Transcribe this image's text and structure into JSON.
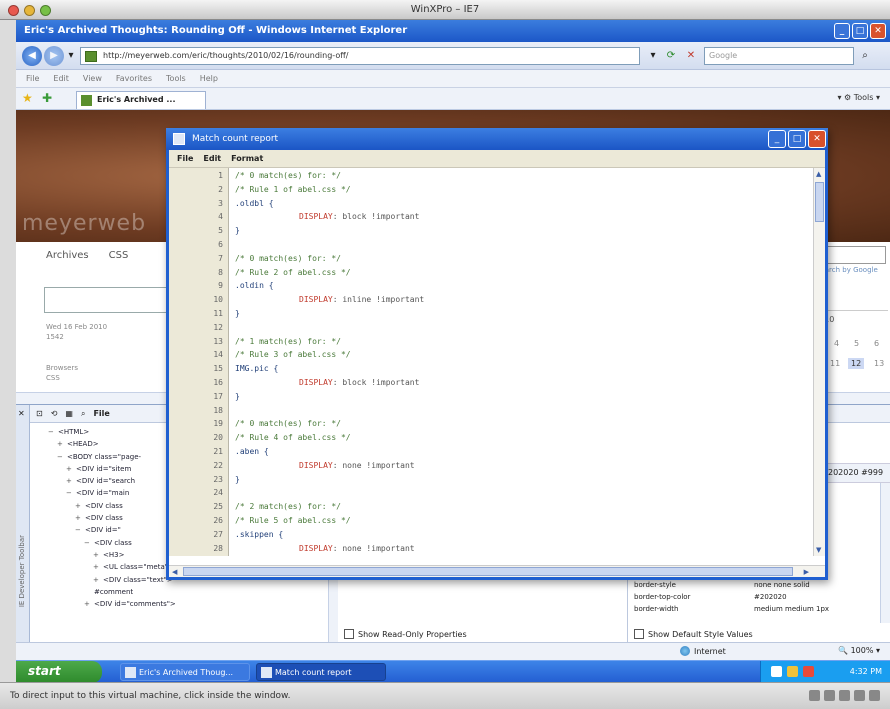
{
  "host": {
    "window_title": "WinXPro – IE7",
    "status_text": "To direct input to this virtual machine, click inside the window."
  },
  "ie": {
    "title": "Eric's Archived Thoughts: Rounding Off - Windows Internet Explorer",
    "address": "http://meyerweb.com/eric/thoughts/2010/02/16/rounding-off/",
    "search_placeholder": "Google",
    "menu": [
      "File",
      "Edit",
      "View",
      "Favorites",
      "Tools",
      "Help"
    ],
    "tab_label": "Eric's Archived ...",
    "tools_label": "Tools",
    "status_zone": "Internet",
    "zoom": "100%"
  },
  "page": {
    "logo_text": "meyerweb",
    "nav": [
      "Archives",
      "CSS"
    ],
    "post_date": [
      "Wed 16 Feb 2010",
      "1542"
    ],
    "post_cat": [
      "Browsers",
      "CSS"
    ],
    "search_by": "Search by Google",
    "calendar_year": "2010",
    "calendar_days": [
      "4",
      "5",
      "6",
      "11",
      "12",
      "13"
    ]
  },
  "devtools": {
    "side_label": "IE Developer Toolbar",
    "toolbar_file": "File",
    "tree": [
      {
        "pm": "−",
        "text": "<HTML>",
        "indent": 0
      },
      {
        "pm": "+",
        "text": "<HEAD>",
        "indent": 1
      },
      {
        "pm": "−",
        "text": "<BODY class=\"page-",
        "indent": 1
      },
      {
        "pm": "+",
        "text": "<DIV id=\"sitem",
        "indent": 2
      },
      {
        "pm": "+",
        "text": "<DIV id=\"search",
        "indent": 2
      },
      {
        "pm": "−",
        "text": "<DIV id=\"main",
        "indent": 2
      },
      {
        "pm": "+",
        "text": "<DIV class",
        "indent": 3
      },
      {
        "pm": "+",
        "text": "<DIV class",
        "indent": 3
      },
      {
        "pm": "−",
        "text": "<DIV id=\"",
        "indent": 3
      },
      {
        "pm": "−",
        "text": "<DIV class",
        "indent": 4
      },
      {
        "pm": "+",
        "text": "<H3>",
        "indent": 5
      },
      {
        "pm": "+",
        "text": "<UL class=\"meta\">",
        "indent": 5
      },
      {
        "pm": "+",
        "text": "<DIV class=\"text\">",
        "indent": 5
      },
      {
        "pm": "",
        "text": "#comment",
        "indent": 4
      },
      {
        "pm": "+",
        "text": "<DIV id=\"comments\">",
        "indent": 4
      }
    ],
    "attrs_footer": "Show Read-Only Properties",
    "styles_footer": "Show Default Style Values",
    "style_color_value": "202020 #999",
    "style_rows": [
      {
        "k": "border-style",
        "v": "none none solid"
      },
      {
        "k": "border-top-color",
        "v": "#202020"
      },
      {
        "k": "border-width",
        "v": "medium medium 1px"
      }
    ]
  },
  "dialog": {
    "title": "Match count report",
    "menu": [
      "File",
      "Edit",
      "Format"
    ],
    "lines": [
      {
        "n": "1",
        "kind": "cm",
        "text": "/* 0 match(es) for: */"
      },
      {
        "n": "2",
        "kind": "cm",
        "text": "/* Rule 1 of abel.css */"
      },
      {
        "n": "3",
        "kind": "sel",
        "text": ".oldbl {"
      },
      {
        "n": "4",
        "kind": "decl",
        "prop": "DISPLAY",
        "val": ": block !important"
      },
      {
        "n": "5",
        "kind": "sel",
        "text": "}"
      },
      {
        "n": "6",
        "kind": "blank",
        "text": ""
      },
      {
        "n": "7",
        "kind": "cm",
        "text": "/* 0 match(es) for: */"
      },
      {
        "n": "8",
        "kind": "cm",
        "text": "/* Rule 2 of abel.css */"
      },
      {
        "n": "9",
        "kind": "sel",
        "text": ".oldin {"
      },
      {
        "n": "10",
        "kind": "decl",
        "prop": "DISPLAY",
        "val": ": inline !important"
      },
      {
        "n": "11",
        "kind": "sel",
        "text": "}"
      },
      {
        "n": "12",
        "kind": "blank",
        "text": ""
      },
      {
        "n": "13",
        "kind": "cm",
        "text": "/* 1 match(es) for: */"
      },
      {
        "n": "14",
        "kind": "cm",
        "text": "/* Rule 3 of abel.css */"
      },
      {
        "n": "15",
        "kind": "sel",
        "text": "IMG.pic {"
      },
      {
        "n": "16",
        "kind": "decl",
        "prop": "DISPLAY",
        "val": ": block !important"
      },
      {
        "n": "17",
        "kind": "sel",
        "text": "}"
      },
      {
        "n": "18",
        "kind": "blank",
        "text": ""
      },
      {
        "n": "19",
        "kind": "cm",
        "text": "/* 0 match(es) for: */"
      },
      {
        "n": "20",
        "kind": "cm",
        "text": "/* Rule 4 of abel.css */"
      },
      {
        "n": "21",
        "kind": "sel",
        "text": ".aben {"
      },
      {
        "n": "22",
        "kind": "decl",
        "prop": "DISPLAY",
        "val": ": none !important"
      },
      {
        "n": "23",
        "kind": "sel",
        "text": "}"
      },
      {
        "n": "24",
        "kind": "blank",
        "text": ""
      },
      {
        "n": "25",
        "kind": "cm",
        "text": "/* 2 match(es) for: */"
      },
      {
        "n": "26",
        "kind": "cm",
        "text": "/* Rule 5 of abel.css */"
      },
      {
        "n": "27",
        "kind": "sel",
        "text": ".skippen {"
      },
      {
        "n": "28",
        "kind": "decl",
        "prop": "DISPLAY",
        "val": ": none !important"
      }
    ]
  },
  "taskbar": {
    "start": "start",
    "tasks": [
      "Eric's Archived Thoug...",
      "Match count report"
    ],
    "time": "4:32 PM"
  },
  "colors": {
    "xp_blue": "#245fd2",
    "start_green": "#2e8a2c",
    "comment": "#4a7a3a",
    "property": "#c0392b"
  }
}
